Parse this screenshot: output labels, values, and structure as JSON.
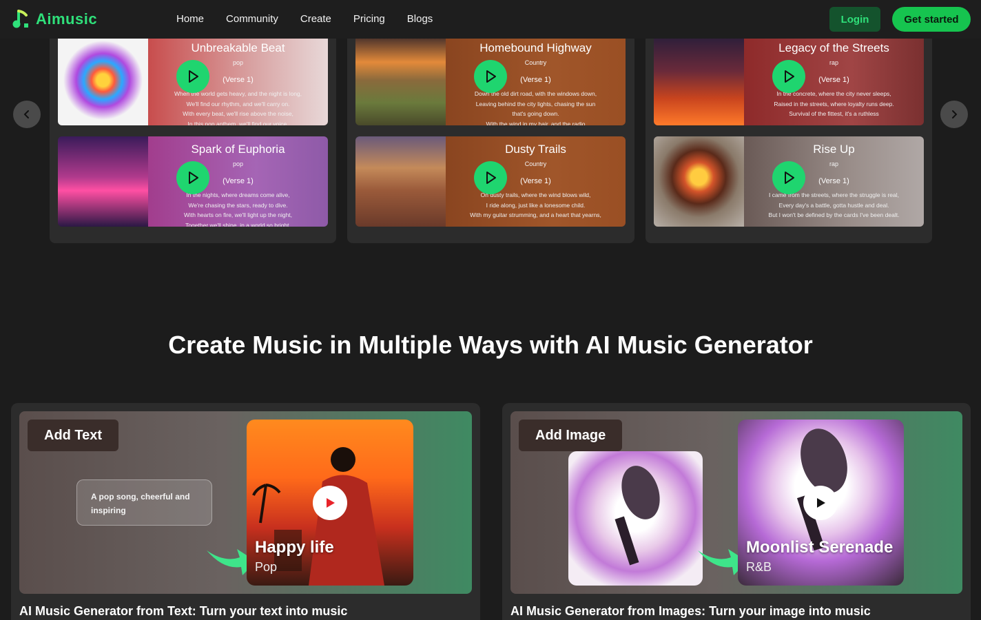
{
  "nav": {
    "logo": "Aimusic",
    "links": [
      "Home",
      "Community",
      "Create",
      "Pricing",
      "Blogs"
    ],
    "login": "Login",
    "get_started": "Get started"
  },
  "songs": [
    {
      "title": "Unbreakable Beat",
      "genre": "pop",
      "verse": "(Verse 1)",
      "lyrics": "When the world gets heavy, and the night is long,\nWe'll find our rhythm, and we'll carry on.\nWith every beat, we'll rise above the noise,\nIn this pop anthem, we'll find our voice."
    },
    {
      "title": "Spark of Euphoria",
      "genre": "pop",
      "verse": "(Verse 1)",
      "lyrics": "In the nights, where dreams come alive,\nWe're chasing the stars, ready to dive.\nWith hearts on fire, we'll light up the night,\nTogether we'll shine, in a world so bright."
    },
    {
      "title": "Homebound Highway",
      "genre": "Country",
      "verse": "(Verse 1)",
      "lyrics": "Down the old dirt road, with the windows down,\nLeaving behind the city lights, chasing the sun that's going down.\nWith the wind in my hair, and the radio"
    },
    {
      "title": "Dusty Trails",
      "genre": "Country",
      "verse": "(Verse 1)",
      "lyrics": "On dusty trails, where the wind blows wild,\nI ride along, just like a lonesome child.\nWith my guitar strumming, and a heart that yearns,"
    },
    {
      "title": "Legacy of the Streets",
      "genre": "rap",
      "verse": "(Verse 1)",
      "lyrics": "In the concrete, where the city never sleeps,\nRaised in the streets, where loyalty runs deep.\nSurvival of the fittest, it's a ruthless"
    },
    {
      "title": "Rise Up",
      "genre": "rap",
      "verse": "(Verse 1)",
      "lyrics": "I came from the streets, where the struggle is real,\nEvery day's a battle, gotta hustle and deal.\nBut I won't be defined by the cards I've been dealt."
    }
  ],
  "section_title": "Create Music in Multiple Ways with AI Music Generator",
  "features": [
    {
      "tag": "Add Text",
      "prompt": "A pop song, cheerful and inspiring",
      "art_title": "Happy life",
      "art_genre": "Pop",
      "caption": "AI Music Generator from Text: Turn your text into music"
    },
    {
      "tag": "Add Image",
      "art_title": "Moonlist Serenade",
      "art_genre": "R&B",
      "caption": "AI Music Generator from Images: Turn your image into music"
    }
  ],
  "colors": {
    "accent": "#1fd56f",
    "brand": "#2fe07a",
    "bg": "#1c1c1c",
    "panel": "#2c2c2c"
  },
  "icons": [
    "music-note-icon",
    "chevron-left-icon",
    "chevron-right-icon",
    "play-icon"
  ]
}
